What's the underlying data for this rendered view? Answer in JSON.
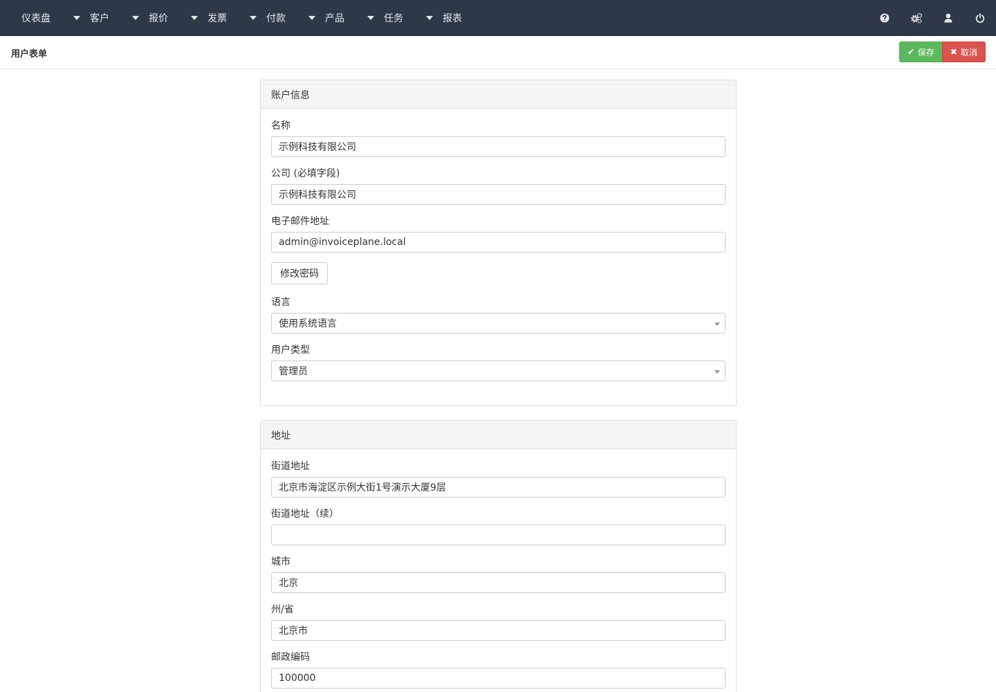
{
  "nav": {
    "items": [
      {
        "label": "仪表盘"
      },
      {
        "label": "客户"
      },
      {
        "label": "报价"
      },
      {
        "label": "发票"
      },
      {
        "label": "付款"
      },
      {
        "label": "产品"
      },
      {
        "label": "任务"
      },
      {
        "label": "报表"
      }
    ],
    "icons": [
      "help-icon",
      "settings-gears-icon",
      "user-icon",
      "power-icon"
    ]
  },
  "header": {
    "title": "用户表单",
    "save_label": "保存",
    "cancel_label": "取消"
  },
  "account_panel": {
    "title": "账户信息",
    "name": {
      "label": "名称",
      "value": "示例科技有限公司"
    },
    "company": {
      "label": "公司 (必填字段)",
      "value": "示例科技有限公司"
    },
    "email": {
      "label": "电子邮件地址",
      "value": "admin@invoiceplane.local"
    },
    "change_password_label": "修改密码",
    "language": {
      "label": "语言",
      "value": "使用系统语言"
    },
    "user_type": {
      "label": "用户类型",
      "value": "管理员"
    }
  },
  "address_panel": {
    "title": "地址",
    "street": {
      "label": "街道地址",
      "value": "北京市海淀区示例大街1号演示大厦9层"
    },
    "street2": {
      "label": "街道地址（续）",
      "value": ""
    },
    "city": {
      "label": "城市",
      "value": "北京"
    },
    "state": {
      "label": "州/省",
      "value": "北京市"
    },
    "zip": {
      "label": "邮政编码",
      "value": "100000"
    }
  },
  "colors": {
    "navbar": "#2e3847",
    "save": "#5cb85c",
    "cancel": "#d9534f"
  }
}
